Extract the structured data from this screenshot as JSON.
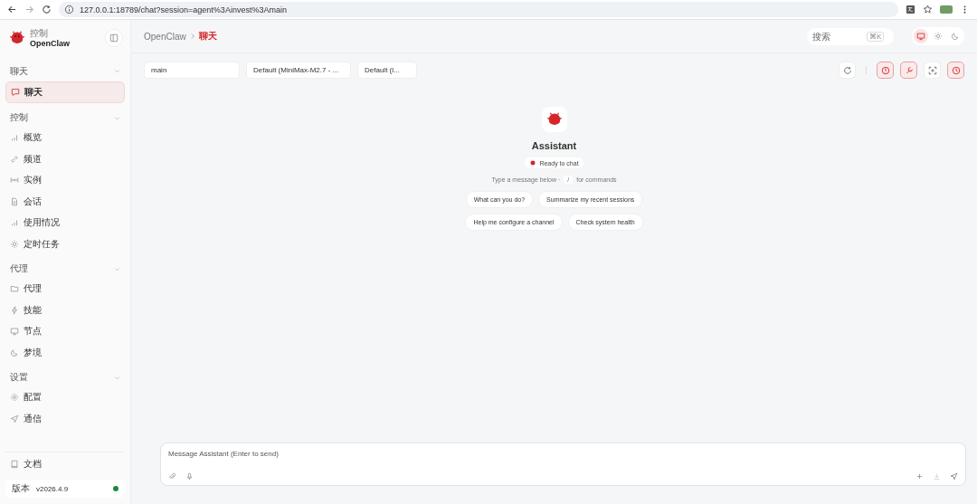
{
  "browser": {
    "url": "127.0.0.1:18789/chat?session=agent%3Ainvest%3Amain"
  },
  "sidebar": {
    "brand_caption": "控制",
    "brand_name": "OpenClaw",
    "sections": [
      {
        "title": "聊天",
        "items": [
          {
            "label": "聊天",
            "selected": true
          }
        ]
      },
      {
        "title": "控制",
        "items": [
          {
            "label": "概览",
            "selected": false
          },
          {
            "label": "频道",
            "selected": false
          },
          {
            "label": "实例",
            "selected": false
          },
          {
            "label": "会话",
            "selected": false
          },
          {
            "label": "使用情况",
            "selected": false
          },
          {
            "label": "定时任务",
            "selected": false
          }
        ]
      },
      {
        "title": "代理",
        "items": [
          {
            "label": "代理",
            "selected": false
          },
          {
            "label": "技能",
            "selected": false
          },
          {
            "label": "节点",
            "selected": false
          },
          {
            "label": "梦境",
            "selected": false
          }
        ]
      },
      {
        "title": "设置",
        "items": [
          {
            "label": "配置",
            "selected": false
          },
          {
            "label": "通信",
            "selected": false
          }
        ]
      }
    ],
    "docs": "文档",
    "version_label": "版本",
    "version": "v2026.4.9",
    "online": true
  },
  "header": {
    "breadcrumb": [
      "OpenClaw",
      "聊天"
    ],
    "search_placeholder": "搜索",
    "search_shortcut": "⌘K",
    "themes": [
      {
        "selected": true
      },
      {
        "selected": false
      },
      {
        "selected": false
      }
    ]
  },
  "toolbar": {
    "selects": [
      "main",
      "Default (MiniMax-M2.7 - ...",
      "Default (l..."
    ],
    "toggles": [
      {
        "on": true
      },
      {
        "on": true
      },
      {
        "on": false
      },
      {
        "on": true
      }
    ]
  },
  "welcome": {
    "title": "Assistant",
    "status": "Ready to chat",
    "hint_before": "Type a message below ·",
    "hint_key": "/",
    "hint_after": "for commands",
    "suggestions": [
      [
        "What can you do?",
        "Summarize my recent sessions"
      ],
      [
        "Help me configure a channel",
        "Check system health"
      ]
    ]
  },
  "composer": {
    "placeholder": "Message Assistant (Enter to send)"
  }
}
